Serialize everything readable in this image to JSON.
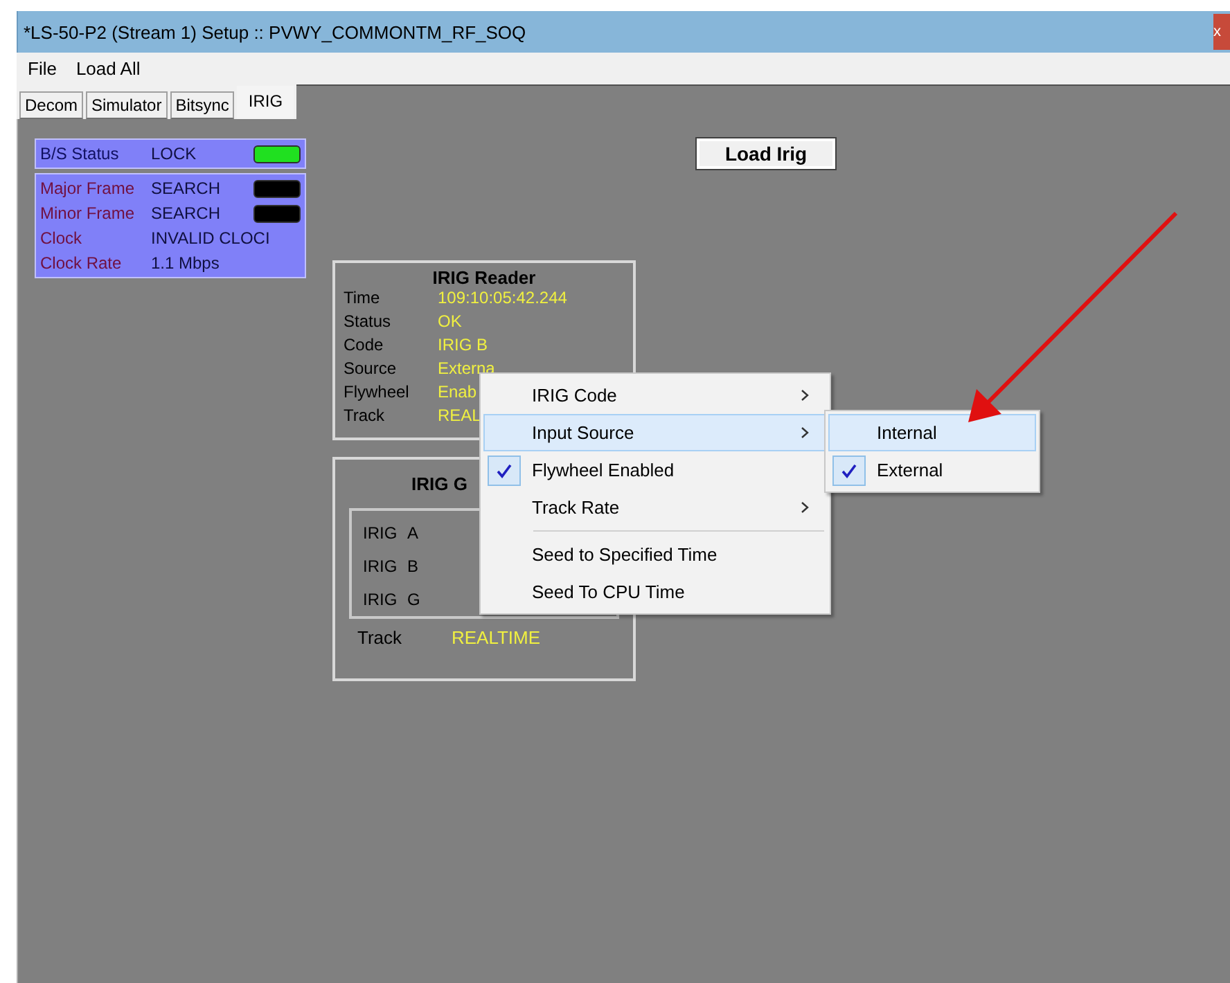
{
  "window": {
    "title": "*LS-50-P2 (Stream 1) Setup :: PVWY_COMMONTM_RF_SOQ",
    "close": "x"
  },
  "menu_bar": [
    "File",
    "Load All"
  ],
  "tabs": [
    {
      "label": "Decom",
      "selected": false
    },
    {
      "label": "Simulator",
      "selected": false
    },
    {
      "label": "Bitsync",
      "selected": false
    },
    {
      "label": "IRIG",
      "selected": true
    }
  ],
  "status_panel": {
    "header": {
      "label": "B/S Status",
      "value": "LOCK",
      "color": "#20e020"
    },
    "rows": [
      {
        "label": "Major Frame",
        "value": "SEARCH",
        "color": "#000000"
      },
      {
        "label": "Minor Frame",
        "value": "SEARCH",
        "color": "#000000"
      },
      {
        "label": "Clock",
        "value": "INVALID CLOCI"
      },
      {
        "label": "Clock Rate",
        "value": "1.1 Mbps"
      }
    ]
  },
  "load_button": "Load Irig",
  "irig_reader": {
    "title": "IRIG Reader",
    "rows": [
      {
        "label": "Time",
        "value": "109:10:05:42.244"
      },
      {
        "label": "Status",
        "value": "OK"
      },
      {
        "label": "Code",
        "value": "IRIG B"
      },
      {
        "label": "Source",
        "value": "Externa"
      },
      {
        "label": "Flywheel",
        "value": "Enab"
      },
      {
        "label": "Track",
        "value": "REAL"
      }
    ]
  },
  "irig_g": {
    "title": "IRIG G",
    "options": [
      {
        "label": "IRIG",
        "letter": "A"
      },
      {
        "label": "IRIG",
        "letter": "B"
      },
      {
        "label": "IRIG",
        "letter": "G"
      }
    ],
    "track_label": "Track",
    "track_value": "REALTIME"
  },
  "context_menu": {
    "items": [
      {
        "kind": "item",
        "label": "IRIG Code",
        "submenu": true,
        "checked": false,
        "selected": false
      },
      {
        "kind": "item",
        "label": "Input Source",
        "submenu": true,
        "checked": false,
        "selected": true
      },
      {
        "kind": "item",
        "label": "Flywheel Enabled",
        "submenu": false,
        "checked": true,
        "selected": false
      },
      {
        "kind": "item",
        "label": "Track Rate",
        "submenu": true,
        "checked": false,
        "selected": false
      },
      {
        "kind": "separator"
      },
      {
        "kind": "item",
        "label": "Seed to Specified Time",
        "submenu": false,
        "checked": false,
        "selected": false
      },
      {
        "kind": "item",
        "label": "Seed To CPU Time",
        "submenu": false,
        "checked": false,
        "selected": false
      }
    ],
    "submenu": [
      {
        "label": "Internal",
        "checked": false,
        "selected": true
      },
      {
        "label": "External",
        "checked": true,
        "selected": false
      }
    ]
  }
}
